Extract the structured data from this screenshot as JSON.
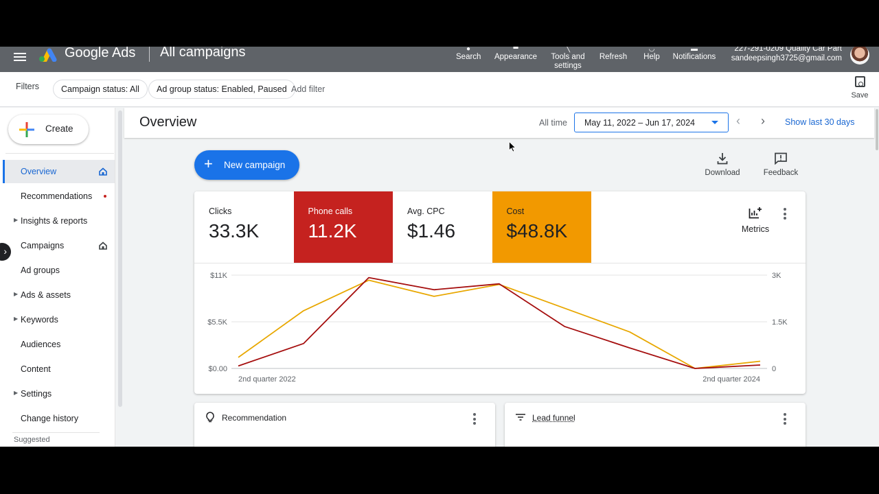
{
  "app": {
    "brand": "Google Ads",
    "title": "All campaigns"
  },
  "topbar": {
    "items": [
      {
        "label": "Search",
        "icon": "search-icon"
      },
      {
        "label": "Appearance",
        "icon": "appearance-icon"
      },
      {
        "label": "Tools and settings",
        "icon": "tools-icon"
      },
      {
        "label": "Refresh",
        "icon": "refresh-icon"
      },
      {
        "label": "Help",
        "icon": "help-icon"
      },
      {
        "label": "Notifications",
        "icon": "bell-icon"
      }
    ],
    "account_id": "227-291-0209 Quality Car Part",
    "account_email": "sandeepsingh3725@gmail.com"
  },
  "filters": {
    "label": "Filters",
    "chips": [
      "Campaign status: All",
      "Ad group status: Enabled, Paused"
    ],
    "add_filter": "Add filter",
    "save": "Save"
  },
  "sidebar": {
    "create": "Create",
    "items": [
      {
        "label": "Overview",
        "active": true,
        "home": true
      },
      {
        "label": "Recommendations",
        "dot": true
      },
      {
        "label": "Insights & reports",
        "caret": true
      },
      {
        "label": "Campaigns",
        "home": true
      },
      {
        "label": "Ad groups"
      },
      {
        "label": "Ads & assets",
        "caret": true
      },
      {
        "label": "Keywords",
        "caret": true
      },
      {
        "label": "Audiences"
      },
      {
        "label": "Content"
      },
      {
        "label": "Settings",
        "caret": true
      },
      {
        "label": "Change history"
      }
    ],
    "suggested": "Suggested"
  },
  "overview": {
    "title": "Overview",
    "all_time": "All time",
    "date_range": "May 11, 2022 – Jun 17, 2024",
    "show_last_30": "Show last 30 days"
  },
  "actions": {
    "new_campaign": "New campaign",
    "download": "Download",
    "feedback": "Feedback"
  },
  "metrics": {
    "tiles": [
      {
        "label": "Clicks",
        "value": "33.3K",
        "bg": "#ffffff",
        "fg": "#202124"
      },
      {
        "label": "Phone calls",
        "value": "11.2K",
        "bg": "#c5221f",
        "fg": "#ffffff"
      },
      {
        "label": "Avg. CPC",
        "value": "$1.46",
        "bg": "#ffffff",
        "fg": "#202124"
      },
      {
        "label": "Cost",
        "value": "$48.8K",
        "bg": "#f29900",
        "fg": "#202124"
      }
    ],
    "metrics_label": "Metrics"
  },
  "chart_data": {
    "type": "line",
    "x_labels": [
      "2nd quarter 2022",
      "2nd quarter 2024"
    ],
    "left_axis": {
      "ticks": [
        "$0.00",
        "$5.5K",
        "$11K"
      ],
      "ylim": [
        0,
        11000
      ]
    },
    "right_axis": {
      "ticks": [
        "0",
        "1.5K",
        "3K"
      ],
      "ylim": [
        0,
        3000
      ]
    },
    "series": [
      {
        "color": "#e8a700",
        "axis": "left",
        "values": [
          1300,
          6800,
          10400,
          8500,
          9900,
          7100,
          4300,
          0,
          850
        ]
      },
      {
        "color": "#a50e0e",
        "axis": "right",
        "values": [
          80,
          800,
          2920,
          2530,
          2720,
          1350,
          660,
          0,
          110
        ]
      }
    ],
    "grid": true
  },
  "cards": {
    "recommendation": "Recommendation",
    "lead_funnel": "Lead funnel"
  },
  "colors": {
    "topbar": "#5f6368",
    "accent": "#1a73e8"
  }
}
